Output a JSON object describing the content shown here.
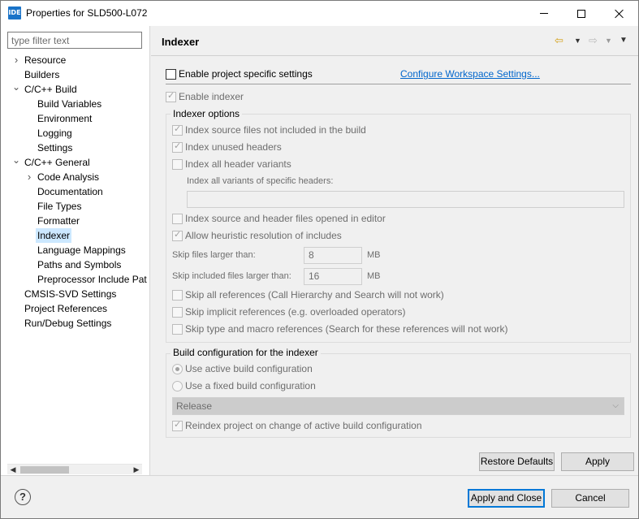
{
  "window": {
    "icon_text": "IDE",
    "title": "Properties for SLD500-L072"
  },
  "sidebar": {
    "filter_placeholder": "type filter text",
    "items": [
      {
        "label": "Resource",
        "level": 0,
        "arrow": "›"
      },
      {
        "label": "Builders",
        "level": 0,
        "arrow": ""
      },
      {
        "label": "C/C++ Build",
        "level": 0,
        "arrow": "⌄"
      },
      {
        "label": "Build Variables",
        "level": 1,
        "arrow": ""
      },
      {
        "label": "Environment",
        "level": 1,
        "arrow": ""
      },
      {
        "label": "Logging",
        "level": 1,
        "arrow": ""
      },
      {
        "label": "Settings",
        "level": 1,
        "arrow": ""
      },
      {
        "label": "C/C++ General",
        "level": 0,
        "arrow": "⌄"
      },
      {
        "label": "Code Analysis",
        "level": 1,
        "arrow": "›"
      },
      {
        "label": "Documentation",
        "level": 1,
        "arrow": ""
      },
      {
        "label": "File Types",
        "level": 1,
        "arrow": ""
      },
      {
        "label": "Formatter",
        "level": 1,
        "arrow": ""
      },
      {
        "label": "Indexer",
        "level": 1,
        "arrow": "",
        "selected": true
      },
      {
        "label": "Language Mappings",
        "level": 1,
        "arrow": ""
      },
      {
        "label": "Paths and Symbols",
        "level": 1,
        "arrow": ""
      },
      {
        "label": "Preprocessor Include Pat",
        "level": 1,
        "arrow": ""
      },
      {
        "label": "CMSIS-SVD Settings",
        "level": 0,
        "arrow": ""
      },
      {
        "label": "Project References",
        "level": 0,
        "arrow": ""
      },
      {
        "label": "Run/Debug Settings",
        "level": 0,
        "arrow": ""
      }
    ]
  },
  "page": {
    "title": "Indexer",
    "enable_project_specific": "Enable project specific settings",
    "configure_workspace_link": "Configure Workspace Settings...",
    "enable_indexer": "Enable indexer",
    "indexer_options_title": "Indexer options",
    "opt_index_source_not_in_build": "Index source files not included in the build",
    "opt_index_unused_headers": "Index unused headers",
    "opt_index_all_header_variants": "Index all header variants",
    "variants_specific_headers_label": "Index all variants of specific headers:",
    "variants_specific_headers_value": "",
    "opt_index_opened_in_editor": "Index source and header files opened in editor",
    "opt_allow_heuristic": "Allow heuristic resolution of includes",
    "skip_files_larger_label": "Skip files larger than:",
    "skip_files_larger_value": "8",
    "skip_files_unit": "MB",
    "skip_included_larger_label": "Skip included files larger than:",
    "skip_included_larger_value": "16",
    "skip_included_unit": "MB",
    "opt_skip_all_refs": "Skip all references (Call Hierarchy and Search will not work)",
    "opt_skip_implicit_refs": "Skip implicit references (e.g. overloaded operators)",
    "opt_skip_type_macro_refs": "Skip type and macro references (Search for these references will not work)",
    "build_config_title": "Build configuration for the indexer",
    "use_active_build_config": "Use active build configuration",
    "use_fixed_build_config": "Use a fixed build configuration",
    "fixed_config_value": "Release",
    "reindex_on_change": "Reindex project on change of active build configuration",
    "restore_defaults": "Restore Defaults",
    "apply": "Apply"
  },
  "footer": {
    "help": "?",
    "apply_and_close": "Apply and Close",
    "cancel": "Cancel"
  },
  "icons": {
    "back": "back-arrow-icon",
    "forward": "forward-arrow-icon",
    "menu": "view-menu-icon"
  }
}
